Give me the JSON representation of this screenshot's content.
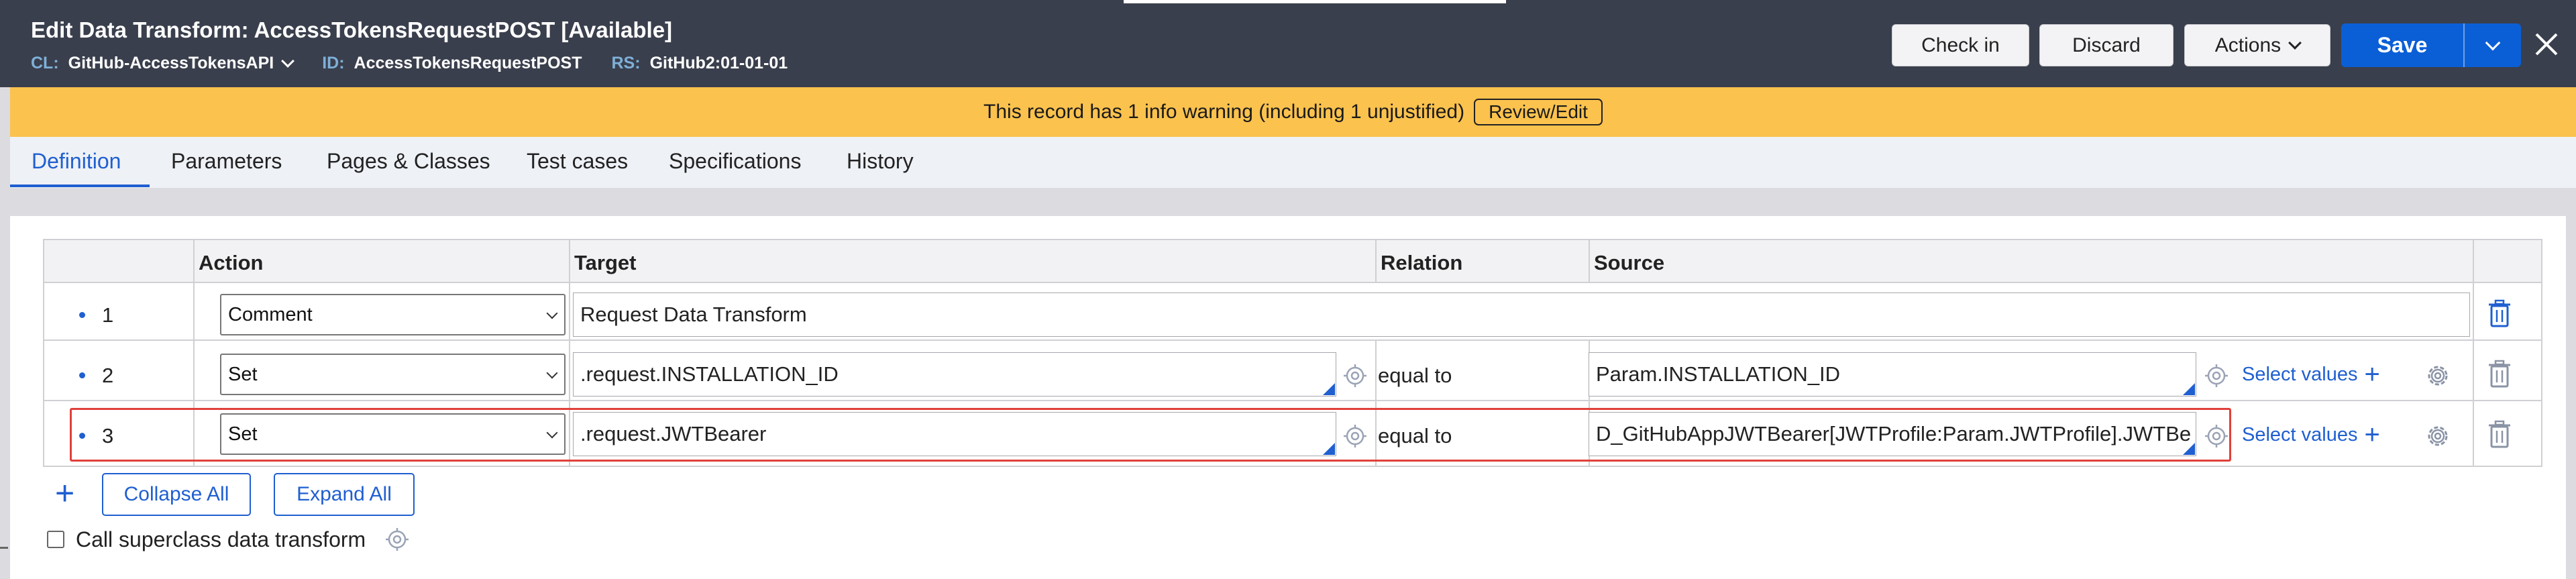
{
  "header": {
    "title": "Edit  Data Transform: AccessTokensRequestPOST [Available]",
    "cl_key": "CL:",
    "cl_value": "GitHub-AccessTokensAPI",
    "id_key": "ID:",
    "id_value": "AccessTokensRequestPOST",
    "rs_key": "RS:",
    "rs_value": "GitHub2:01-01-01",
    "checkin_label": "Check in",
    "discard_label": "Discard",
    "actions_label": "Actions",
    "save_label": "Save"
  },
  "warning": {
    "text": "This record has 1 info warning (including 1 unjustified)",
    "review_label": "Review/Edit"
  },
  "tabs": [
    {
      "label": "Definition"
    },
    {
      "label": "Parameters"
    },
    {
      "label": "Pages & Classes"
    },
    {
      "label": "Test cases"
    },
    {
      "label": "Specifications"
    },
    {
      "label": "History"
    }
  ],
  "grid": {
    "headers": {
      "action": "Action",
      "target": "Target",
      "relation": "Relation",
      "source": "Source"
    },
    "rows": [
      {
        "num": "1",
        "action": "Comment",
        "comment": "Request Data Transform"
      },
      {
        "num": "2",
        "action": "Set",
        "target": ".request.INSTALLATION_ID",
        "relation": "equal to",
        "source": "Param.INSTALLATION_ID",
        "select_values": "Select values"
      },
      {
        "num": "3",
        "action": "Set",
        "target": ".request.JWTBearer",
        "relation": "equal to",
        "source": "D_GitHubAppJWTBearer[JWTProfile:Param.JWTProfile].JWTBe",
        "select_values": "Select values"
      }
    ]
  },
  "footer": {
    "collapse_label": "Collapse All",
    "expand_label": "Expand All",
    "superclass_label": "Call superclass data transform"
  },
  "colors": {
    "header_bg": "#3a3f4d",
    "accent": "#0b5fd6",
    "warning_bg": "#fbc24e",
    "highlight": "#e0403a"
  }
}
